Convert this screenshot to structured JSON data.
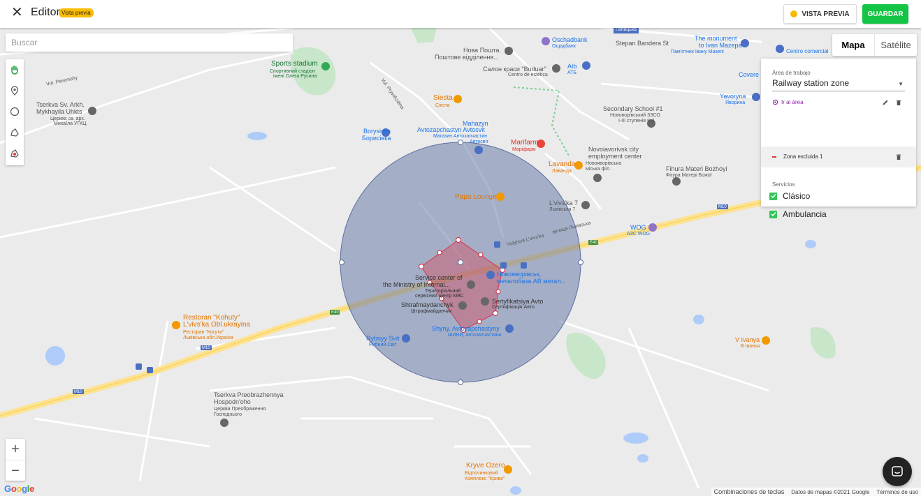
{
  "header": {
    "close_icon": "close-icon",
    "title": "Editor",
    "badge": "Vista previa",
    "preview_button": "VISTA PREVIA",
    "save_button": "GUARDAR",
    "colors": {
      "save": "#14c445",
      "badge": "#fbbc04"
    }
  },
  "search": {
    "placeholder": "Buscar"
  },
  "tools": [
    "hand-icon",
    "pin-icon",
    "circle-icon",
    "polygon-icon",
    "exclude-zone-icon"
  ],
  "map_type": {
    "map": "Mapa",
    "satellite": "Satélite",
    "selected": "Mapa"
  },
  "panel": {
    "area_label": "Área de trabajo",
    "area_value": "Railway station zone",
    "goto_label": "Ir al área",
    "excluded_zone": "Zona excluida 1",
    "services_label": "Servicios",
    "services": [
      {
        "label": "Clásico",
        "checked": true
      },
      {
        "label": "Ambulancia",
        "checked": true
      }
    ]
  },
  "map_labels": {
    "sports": "Sports stadium",
    "sports_sub": "Спортивний стадіон",
    "sports_sub2": "імені Олега Русина",
    "nova_poshta": "Нова Пошта.",
    "nova_poshta_sub": "Поштове відділення...",
    "oschadbank": "Oschadbank",
    "oschadbank_sub": "Ощадбанк",
    "stepan": "Stepan Bandera St",
    "monument": "The monument",
    "monument2": "to Ivan Mazepa",
    "monument_sub": "Пам'ятник Івану Мазепі",
    "centro": "Centro comercial",
    "salon": "Салон краси \"Buduar\"",
    "salon_sub": "Centro de estética",
    "atb": "Atb",
    "atb_sub": "АТБ",
    "church": "Tserkva Sv. Arkh.",
    "church2": "Mykhayila Uhkts",
    "church_sub": "Церква св. арх.",
    "church_sub2": "Михаїла УГКЦ",
    "siesta": "Siesta",
    "siesta_sub": "Сієста",
    "secondary": "Secondary School #1",
    "secondary_sub": "Нововорівський ЗЗСО",
    "secondary_sub2": "І-ІІІ ступенів №1",
    "yavoryna": "Yavoryna",
    "yavoryna_sub": "Яворина",
    "covered": "Covere",
    "mahazyn": "Mahazyn",
    "avto": "Avtozapchastyn Avtosvit",
    "avto_sub": "Магазин Автозапчастин",
    "avto_sub2": "Автосвіт",
    "borysivka": "Borysivka",
    "borysivka_sub": "Борисівка",
    "marifarm": "Marifarm",
    "marifarm_sub": "Марiфарм",
    "novo": "Novoiavorivsk city",
    "novo2": "employment center",
    "novo_sub": "Новояворівська",
    "novo_sub2": "міська філ.",
    "lavanda": "Lavanda",
    "lavanda_sub": "Лаванда",
    "fihura": "Fihura Materi Bozhoyi",
    "fihura_sub": "Фігура Матері Божої",
    "papa": "Papa Lounge",
    "lviv7": "L'vivs'ka 7",
    "lviv7_sub": "Львівська 7",
    "wog": "WOG",
    "wog_sub": "АЗС WOG",
    "service": "Service center of",
    "service2": "the Ministry of Internal...",
    "service_sub": "Територіальний",
    "service_sub2": "сервісний центр МВС",
    "novoyav": "Новояворівськ,",
    "metal": "металобаза АВ метал...",
    "shtraf": "Shtrafmaydanchyk",
    "shtraf_sub": "Штрафмайданчик",
    "sertyf": "Sertyfikatsiya Avto",
    "sertyf_sub": "Сертифікація Авто",
    "shyny": "Shyny, Avtozapchastyny",
    "shyny_sub": "ШИНИ, автозапчастини",
    "rybnyy": "Rybnyy Svit",
    "rybnyy_sub": "Рибний Світ",
    "restoran": "Restoran \"Kohuty\"",
    "restoran2": "L'vivs'ka Obl.ukrayina",
    "restoran_sub": "Ресторан \"Когути\"",
    "restoran_sub2": "Львівська обл.Україна",
    "ivanya": "V Ivanya",
    "ivanya_sub": "В Іванья",
    "preobr": "Tserkva Preobrazhennya",
    "preobr2": "Hospodn'oho",
    "preobr_sub": "Церква Преображення",
    "preobr_sub2": "Господнього",
    "kryve": "Kryve Ozero",
    "kryve_sub": "Відпочинковий",
    "kryve_sub2": "Комплекс \"Криве\"",
    "vul_peremohy": "Vul. Peremohy",
    "vul_pryvokz": "Vul. Pryvokzalna",
    "lvivska": "Vulytsya L'vivs'ka",
    "lvivska2": "вулиця Львівська",
    "m10": "M10",
    "e40": "E40",
    "halytska": "Галицька"
  },
  "footer": {
    "google": "Google",
    "shortcuts": "Combinaciones de teclas",
    "data": "Datos de mapas ©2021 Google",
    "terms": "Términos de uso"
  },
  "zoom": {
    "in": "+",
    "out": "−"
  }
}
